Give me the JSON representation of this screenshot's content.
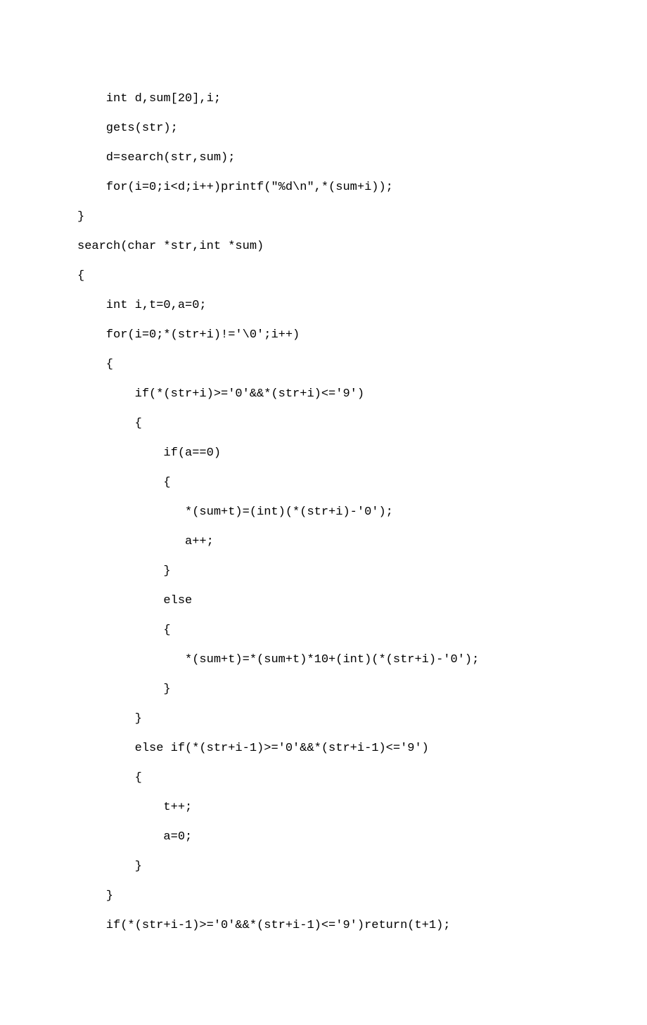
{
  "code": {
    "lines": [
      "    int d,sum[20],i;",
      "    gets(str);",
      "    d=search(str,sum);",
      "    for(i=0;i<d;i++)printf(\"%d\\n\",*(sum+i));",
      "}",
      "search(char *str,int *sum)",
      "{",
      "    int i,t=0,a=0;",
      "    for(i=0;*(str+i)!='\\0';i++)",
      "    {",
      "        if(*(str+i)>='0'&&*(str+i)<='9')",
      "        {",
      "            if(a==0)",
      "            {",
      "               *(sum+t)=(int)(*(str+i)-'0');",
      "               a++;",
      "            }",
      "            else",
      "            {",
      "               *(sum+t)=*(sum+t)*10+(int)(*(str+i)-'0');",
      "            }",
      "        }",
      "        else if(*(str+i-1)>='0'&&*(str+i-1)<='9')",
      "        {",
      "            t++;",
      "            a=0;",
      "        }",
      "    }",
      "    if(*(str+i-1)>='0'&&*(str+i-1)<='9')return(t+1);"
    ]
  }
}
